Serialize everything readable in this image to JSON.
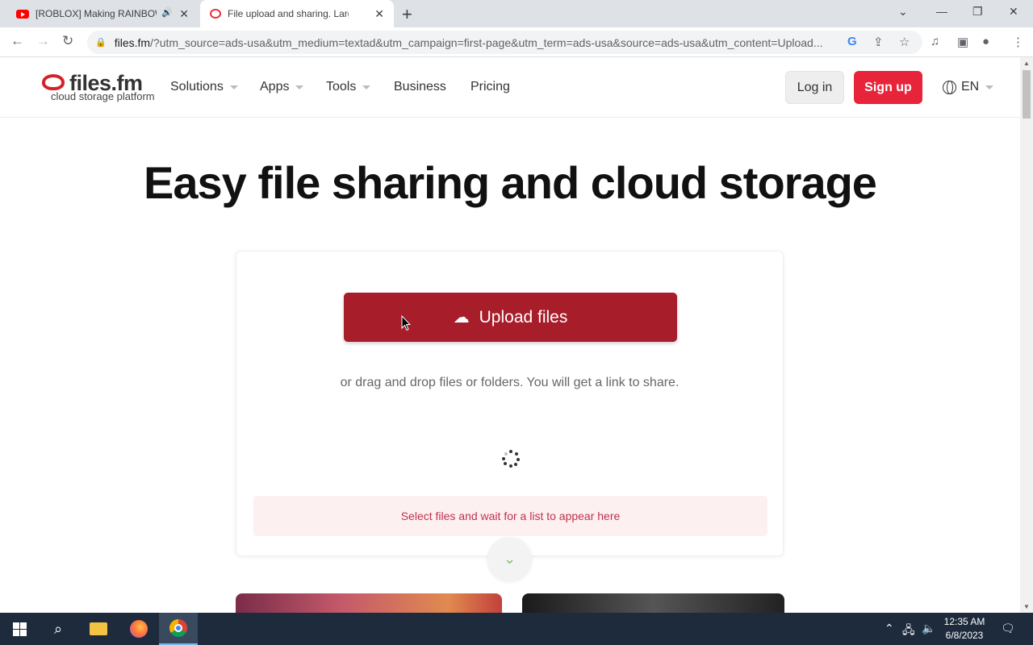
{
  "browser": {
    "tabs": [
      {
        "title": "[ROBLOX] Making RAINBOW",
        "icon": "youtube-icon"
      },
      {
        "title": "File upload and sharing. Large fil",
        "icon": "filesfm-icon"
      }
    ],
    "url_host": "files.fm",
    "url_rest": "/?utm_source=ads-usa&utm_medium=textad&utm_campaign=first-page&utm_term=ads-usa&source=ads-usa&utm_content=Upload..."
  },
  "header": {
    "logo_name": "files.fm",
    "logo_tagline": "cloud storage platform",
    "nav": {
      "solutions": "Solutions",
      "apps": "Apps",
      "tools": "Tools",
      "business": "Business",
      "pricing": "Pricing"
    },
    "login": "Log in",
    "signup": "Sign up",
    "lang": "EN"
  },
  "main": {
    "title": "Easy file sharing and cloud storage",
    "upload_button": "Upload files",
    "drop_hint": "or drag and drop files or folders. You will get a link to share.",
    "list_hint": "Select files and wait for a list to appear here"
  },
  "taskbar": {
    "time": "12:35 AM",
    "date": "6/8/2023"
  },
  "colors": {
    "brand_red": "#e8243a",
    "upload_red": "#a71d2a",
    "list_hint_bg": "#fdf0f1"
  }
}
